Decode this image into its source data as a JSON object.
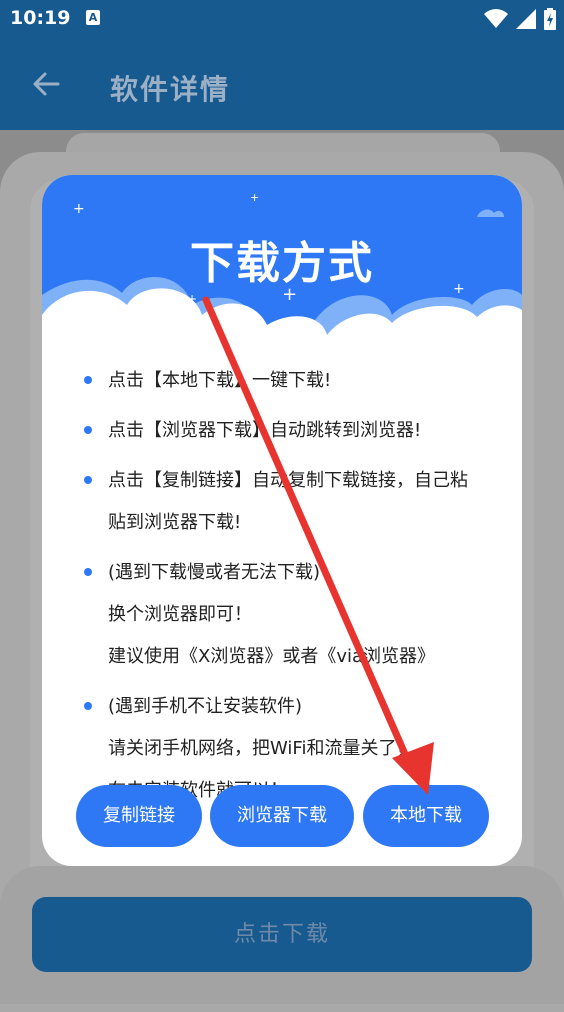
{
  "status_bar": {
    "time": "10:19",
    "notif_letter": "A"
  },
  "app_bar": {
    "title": "软件详情"
  },
  "bottom_button_label": "点击下载",
  "dialog": {
    "title": "下载方式",
    "items": [
      {
        "lines": [
          "点击【本地下载】一键下载!"
        ]
      },
      {
        "lines": [
          "点击【浏览器下载】自动跳转到浏览器!"
        ]
      },
      {
        "lines": [
          "点击【复制链接】自动复制下载链接，自己粘",
          "贴到浏览器下载!"
        ]
      },
      {
        "lines": [
          "(遇到下载慢或者无法下载)",
          "换个浏览器即可！",
          "建议使用《X浏览器》或者《via浏览器》"
        ]
      },
      {
        "lines": [
          "(遇到手机不让安装软件)",
          "请关闭手机网络，把WiFi和流量关了，",
          "在去安装软件就可以！"
        ]
      }
    ],
    "buttons": {
      "copy": "复制链接",
      "browser": "浏览器下载",
      "local": "本地下载"
    }
  },
  "colors": {
    "app_bar": "#175a8f",
    "accent": "#2f78f5",
    "arrow": "#e8342e"
  }
}
